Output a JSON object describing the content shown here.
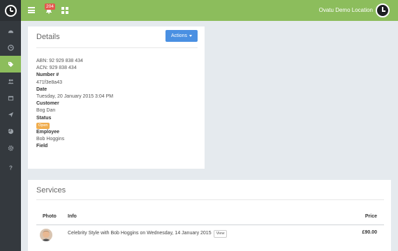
{
  "header": {
    "notification_count": "204",
    "location": "Ovatu Demo Location"
  },
  "sidebar": {
    "items": [
      {
        "icon": "dashboard-icon",
        "active": false
      },
      {
        "icon": "clock-icon",
        "active": false
      },
      {
        "icon": "tag-icon",
        "active": true
      },
      {
        "icon": "users-icon",
        "active": false
      },
      {
        "icon": "calendar-icon",
        "active": false
      },
      {
        "icon": "send-icon",
        "active": false
      },
      {
        "icon": "pie-chart-icon",
        "active": false
      },
      {
        "icon": "gear-icon",
        "active": false
      },
      {
        "icon": "help-icon",
        "active": false
      }
    ]
  },
  "details": {
    "title": "Details",
    "actions_label": "Actions",
    "abn": "ABN: 92 929 838 434",
    "acn": "ACN: 929 838 434",
    "number_label": "Number #",
    "number_value": "471f3e8a43",
    "date_label": "Date",
    "date_value": "Tuesday, 20 January 2015 3:04 PM",
    "customer_label": "Customer",
    "customer_value": "Bog Dan",
    "status_label": "Status",
    "status_value": "Open",
    "employee_label": "Employee",
    "employee_value": "Bob Hoggins",
    "field_label": "Field"
  },
  "services": {
    "title": "Services",
    "columns": {
      "photo": "Photo",
      "info": "Info",
      "price": "Price"
    },
    "rows": [
      {
        "info": "Celebrity Style with Bob Hoggins on Wednesday, 14 January 2015",
        "view_label": "View",
        "price": "£90.00"
      }
    ]
  },
  "colors": {
    "accent_green": "#8cbd5c",
    "sidebar": "#34393e",
    "button_blue": "#4a90e2",
    "status_orange": "#f0ad4e"
  }
}
